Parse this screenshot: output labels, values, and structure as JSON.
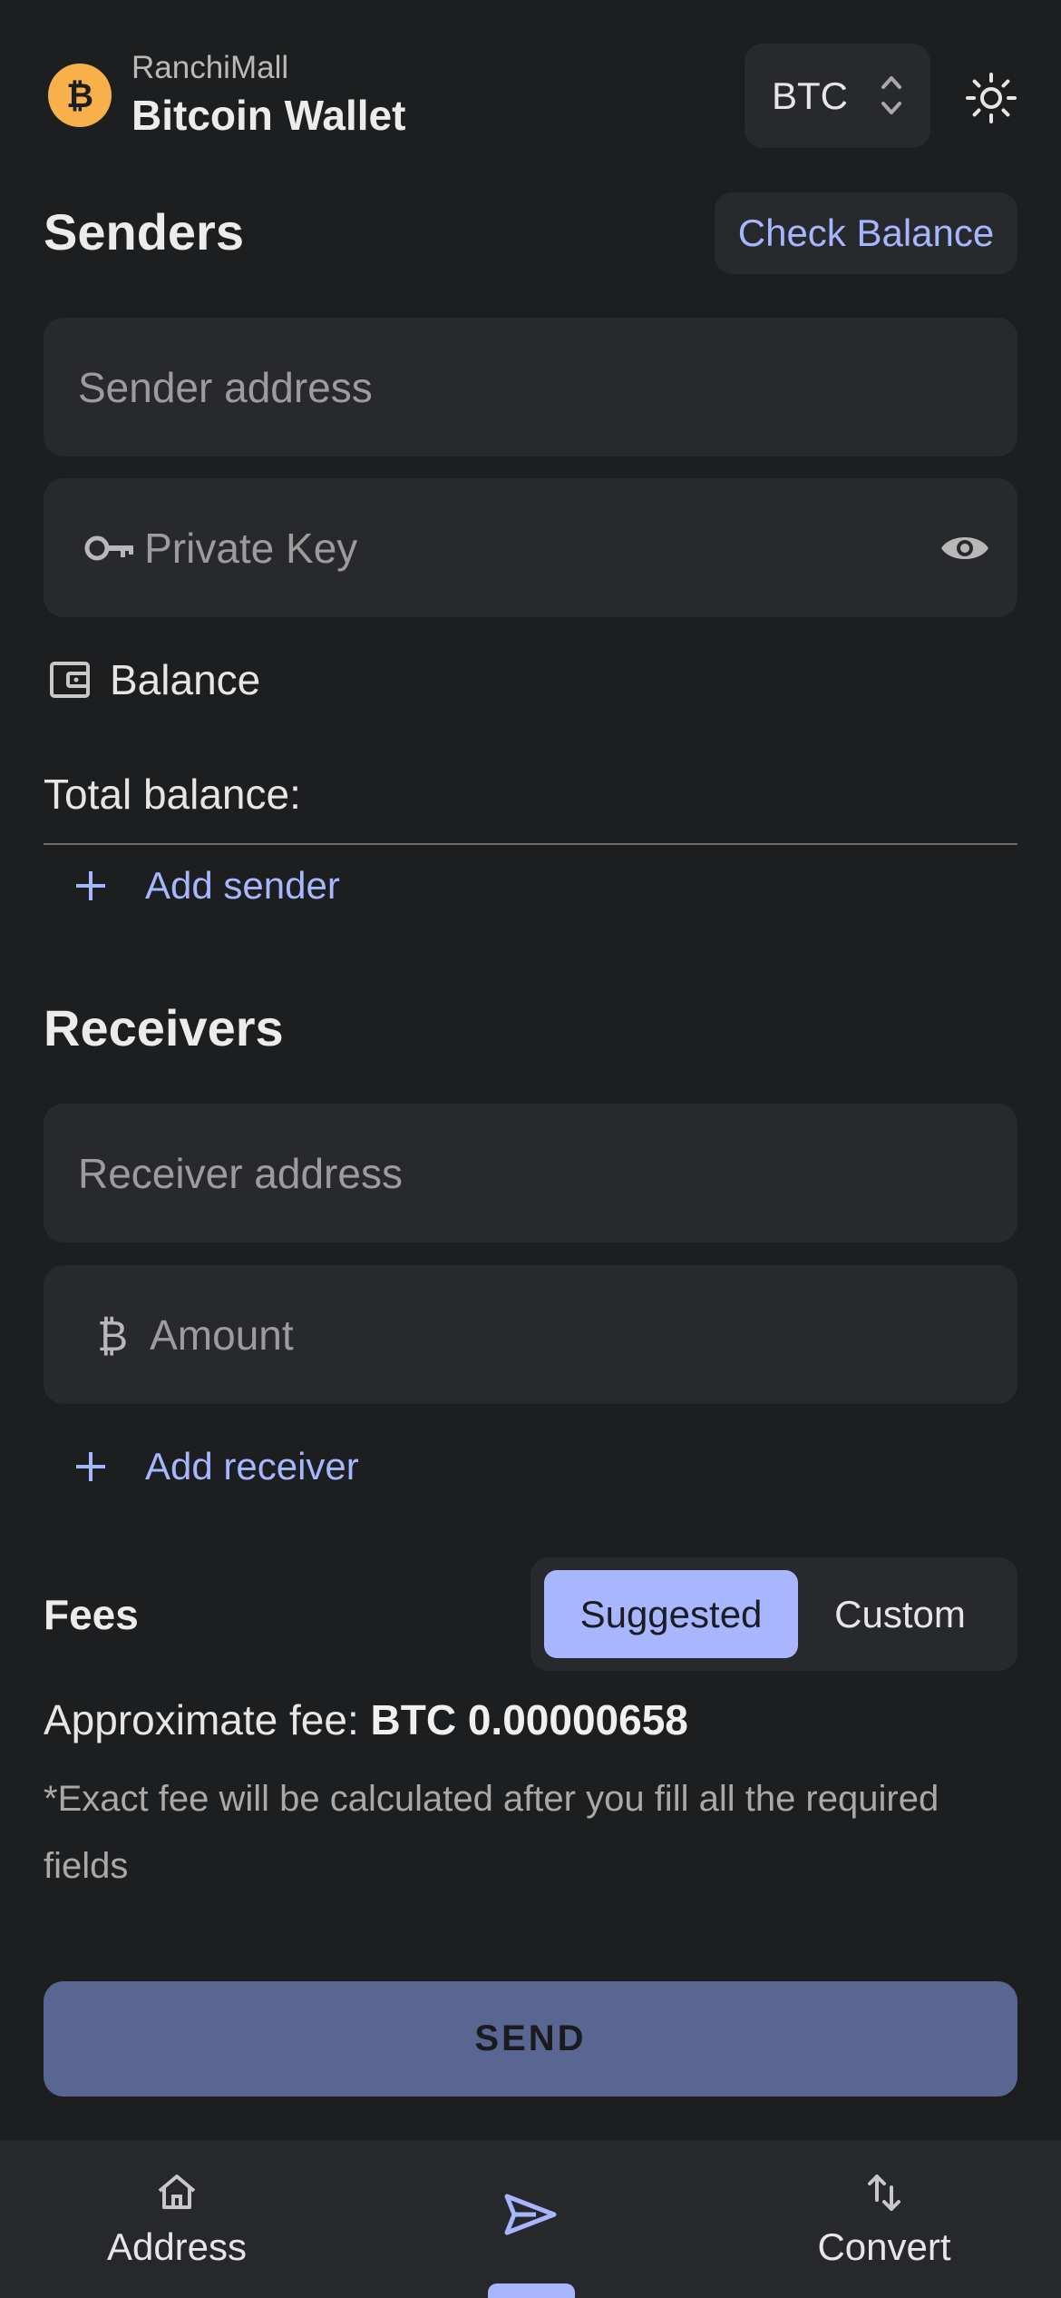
{
  "header": {
    "brand_sub": "RanchiMall",
    "brand_title": "Bitcoin Wallet",
    "coin": "BTC"
  },
  "senders": {
    "title": "Senders",
    "check_balance": "Check Balance",
    "address_placeholder": "Sender address",
    "key_placeholder": "Private Key",
    "balance_label": "Balance",
    "total_balance": "Total balance:",
    "add_sender": "Add sender"
  },
  "receivers": {
    "title": "Receivers",
    "address_placeholder": "Receiver address",
    "amount_placeholder": "Amount",
    "add_receiver": "Add receiver"
  },
  "fees": {
    "title": "Fees",
    "options": [
      "Suggested",
      "Custom"
    ],
    "approx_label": "Approximate fee:",
    "approx_value": "BTC 0.00000658",
    "note": "*Exact fee will be calculated after you fill all the required fields"
  },
  "send_label": "SEND",
  "nav": {
    "address": "Address",
    "convert": "Convert"
  },
  "colors": {
    "accent": "#a7b6ff",
    "bitcoin": "#f7b04a",
    "background": "#1d1e20",
    "surface": "#28292c"
  }
}
